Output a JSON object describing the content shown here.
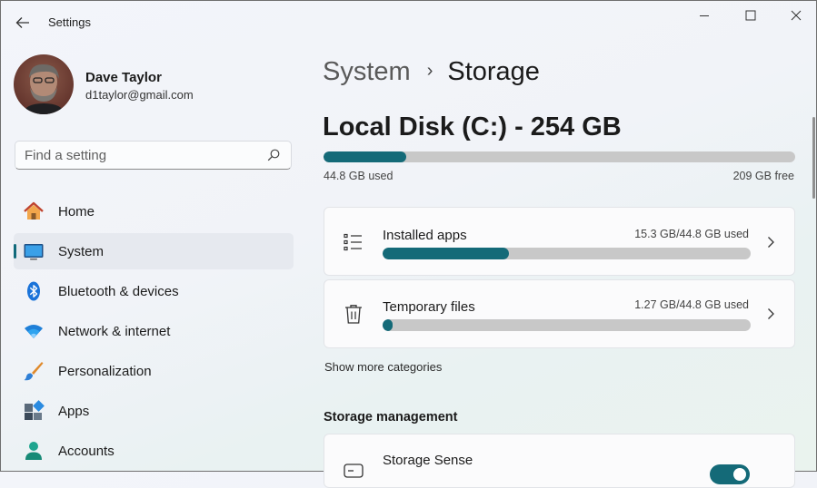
{
  "window": {
    "title": "Settings"
  },
  "profile": {
    "name": "Dave Taylor",
    "email": "d1taylor@gmail.com"
  },
  "search": {
    "placeholder": "Find a setting"
  },
  "nav": {
    "items": [
      {
        "label": "Home",
        "icon": "home-icon"
      },
      {
        "label": "System",
        "icon": "system-icon",
        "active": true
      },
      {
        "label": "Bluetooth & devices",
        "icon": "bluetooth-icon"
      },
      {
        "label": "Network & internet",
        "icon": "wifi-icon"
      },
      {
        "label": "Personalization",
        "icon": "paintbrush-icon"
      },
      {
        "label": "Apps",
        "icon": "apps-icon"
      },
      {
        "label": "Accounts",
        "icon": "accounts-icon"
      }
    ]
  },
  "breadcrumb": {
    "parent": "System",
    "separator": "›",
    "current": "Storage"
  },
  "disk": {
    "title": "Local Disk (C:) - 254 GB",
    "used_label": "44.8 GB used",
    "free_label": "209 GB free",
    "used_fraction": 0.176
  },
  "categories": [
    {
      "title": "Installed apps",
      "size": "15.3 GB/44.8 GB used",
      "icon": "list-icon",
      "fraction": 0.342
    },
    {
      "title": "Temporary files",
      "size": "1.27 GB/44.8 GB used",
      "icon": "trash-icon",
      "fraction": 0.028
    }
  ],
  "show_more": "Show more categories",
  "storage_management": {
    "heading": "Storage management",
    "items": [
      {
        "title": "Storage Sense",
        "icon": "drive-icon",
        "toggle": "on"
      }
    ]
  },
  "colors": {
    "accent": "#146a78",
    "track": "#c8c8c8"
  }
}
